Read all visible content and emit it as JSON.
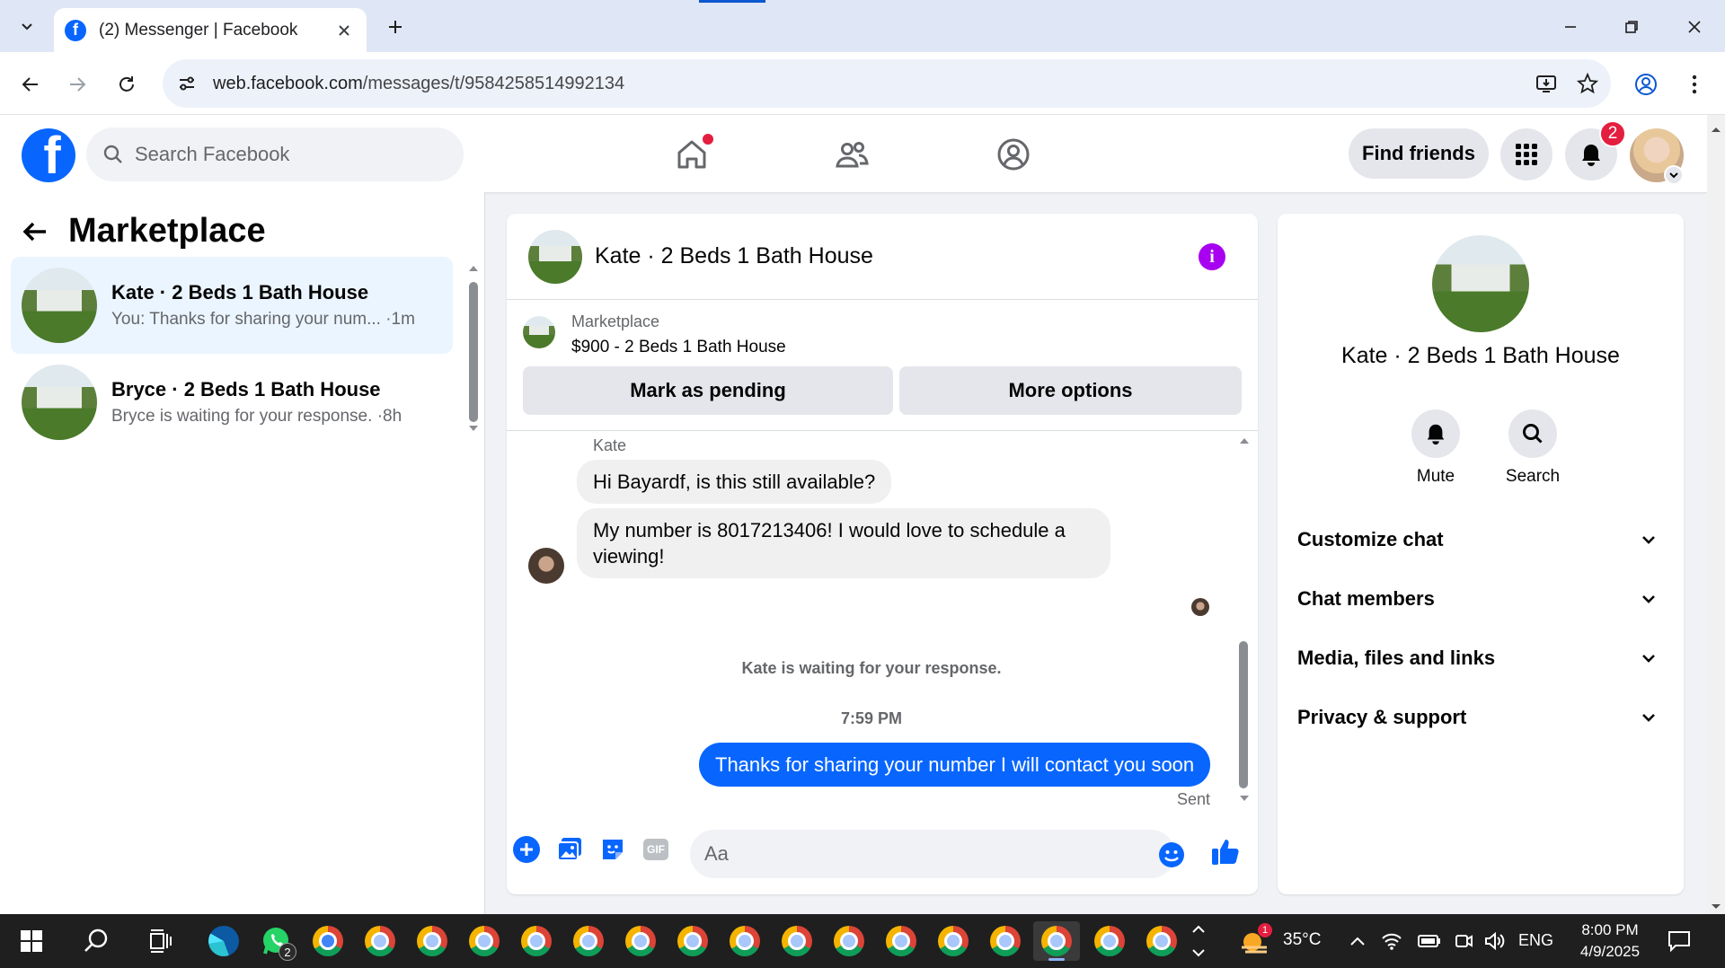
{
  "browser": {
    "tab_title": "(2) Messenger | Facebook",
    "url_host": "web.facebook.com",
    "url_path": "/messages/t/9584258514992134"
  },
  "fb_header": {
    "search_placeholder": "Search Facebook",
    "find_friends": "Find friends",
    "notification_count": "2"
  },
  "left_panel": {
    "title": "Marketplace",
    "conversations": [
      {
        "name": "Kate · 2 Beds 1 Bath House",
        "preview": "You: Thanks for sharing your num...",
        "time": "·1m",
        "active": true
      },
      {
        "name": "Bryce · 2 Beds 1 Bath House",
        "preview": "Bryce is waiting for your response.",
        "time": "·8h",
        "active": false
      }
    ]
  },
  "chat": {
    "title": "Kate · 2 Beds 1 Bath House",
    "listing": {
      "source": "Marketplace",
      "title": "$900 - 2 Beds 1 Bath House",
      "mark_pending": "Mark as pending",
      "more_options": "More options"
    },
    "messages": {
      "sender_name": "Kate",
      "incoming_1": "Hi Bayardf, is this still available?",
      "incoming_2": "My number is 8017213406! I would love to schedule a viewing!",
      "waiting": "Kate is waiting for your response.",
      "timestamp": "7:59 PM",
      "outgoing_1": "Thanks for sharing your number I will contact you soon",
      "status": "Sent"
    },
    "composer": {
      "placeholder": "Aa",
      "gif_label": "GIF"
    }
  },
  "right_panel": {
    "name": "Kate · 2 Beds 1 Bath House",
    "actions": [
      {
        "label": "Mute",
        "icon": "bell-icon"
      },
      {
        "label": "Search",
        "icon": "search-icon"
      }
    ],
    "sections": [
      {
        "label": "Customize chat"
      },
      {
        "label": "Chat members"
      },
      {
        "label": "Media, files and links"
      },
      {
        "label": "Privacy & support"
      }
    ]
  },
  "taskbar": {
    "weather_temp": "35°C",
    "weather_badge": "1",
    "language": "ENG",
    "time": "8:00 PM",
    "date": "4/9/2025",
    "whatsapp_badge": "2"
  },
  "colors": {
    "fb_blue": "#0866ff",
    "messenger_info": "#a800f0",
    "notification_red": "#e41e3f",
    "active_conv_bg": "#ebf5ff"
  }
}
